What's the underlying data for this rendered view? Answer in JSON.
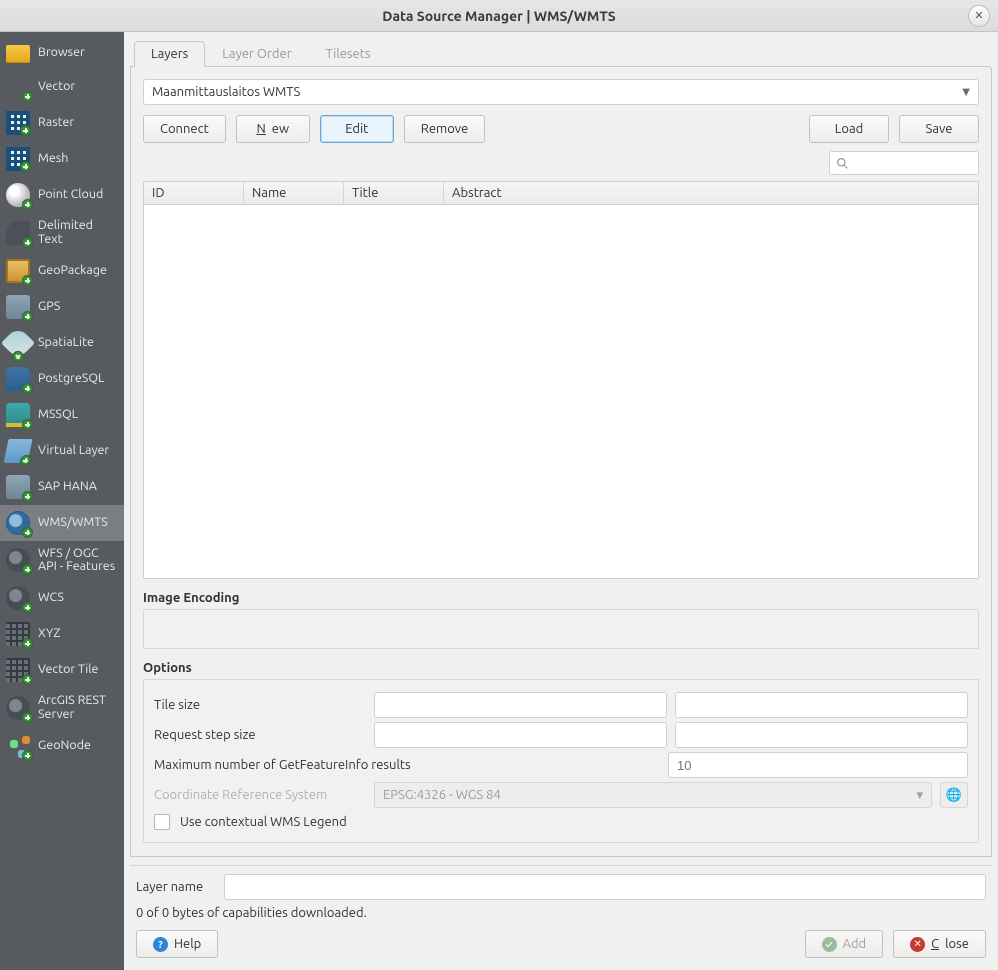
{
  "window": {
    "title": "Data Source Manager | WMS/WMTS"
  },
  "sidebar": {
    "items": [
      {
        "label": "Browser",
        "icon": "folder-icon",
        "iconcls": "ic-folder"
      },
      {
        "label": "Vector",
        "icon": "vector-icon",
        "iconcls": ""
      },
      {
        "label": "Raster",
        "icon": "raster-icon",
        "iconcls": "ic-grid"
      },
      {
        "label": "Mesh",
        "icon": "mesh-icon",
        "iconcls": "ic-grid"
      },
      {
        "label": "Point Cloud",
        "icon": "point-cloud-icon",
        "iconcls": "ic-ball"
      },
      {
        "label": "Delimited Text",
        "icon": "delimited-icon",
        "iconcls": "ic-quote"
      },
      {
        "label": "GeoPackage",
        "icon": "geopkg-icon",
        "iconcls": "ic-box"
      },
      {
        "label": "GPS",
        "icon": "gps-icon",
        "iconcls": "ic-badge"
      },
      {
        "label": "SpatiaLite",
        "icon": "spatialite-icon",
        "iconcls": "ic-leaf"
      },
      {
        "label": "PostgreSQL",
        "icon": "postgres-icon",
        "iconcls": "ic-elephant"
      },
      {
        "label": "MSSQL",
        "icon": "mssql-icon",
        "iconcls": "ic-teal"
      },
      {
        "label": "Virtual Layer",
        "icon": "vlayer-icon",
        "iconcls": "ic-layers"
      },
      {
        "label": "SAP HANA",
        "icon": "hana-icon",
        "iconcls": "ic-badge"
      },
      {
        "label": "WMS/WMTS",
        "icon": "wms-icon",
        "iconcls": "ic-globe",
        "selected": true
      },
      {
        "label": "WFS / OGC API - Features",
        "icon": "wfs-icon",
        "iconcls": "ic-globedark"
      },
      {
        "label": "WCS",
        "icon": "wcs-icon",
        "iconcls": "ic-globedark"
      },
      {
        "label": "XYZ",
        "icon": "xyz-icon",
        "iconcls": "ic-tiles"
      },
      {
        "label": "Vector Tile",
        "icon": "vectortile-icon",
        "iconcls": "ic-tiles"
      },
      {
        "label": "ArcGIS REST Server",
        "icon": "arcgis-icon",
        "iconcls": "ic-globedark"
      },
      {
        "label": "GeoNode",
        "icon": "geonode-icon",
        "iconcls": "ic-node"
      }
    ]
  },
  "tabs": {
    "items": [
      {
        "label": "Layers",
        "active": true
      },
      {
        "label": "Layer Order",
        "active": false
      },
      {
        "label": "Tilesets",
        "active": false
      }
    ]
  },
  "connection": {
    "selected": "Maanmittauslaitos WMTS"
  },
  "buttons": {
    "connect": "Connect",
    "newbtn": "New",
    "edit": "Edit",
    "remove": "Remove",
    "load": "Load",
    "save": "Save"
  },
  "table": {
    "columns": {
      "id": "ID",
      "name": "Name",
      "title": "Title",
      "abstract": "Abstract"
    }
  },
  "image_encoding": {
    "title": "Image Encoding"
  },
  "options": {
    "title": "Options",
    "tile_size": "Tile size",
    "request_step": "Request step size",
    "max_feature_info": "Maximum number of GetFeatureInfo results",
    "max_feature_info_value": "10",
    "crs_label": "Coordinate Reference System",
    "crs_value": "EPSG:4326 - WGS 84",
    "contextual": "Use contextual WMS Legend"
  },
  "layer_name": {
    "label": "Layer name",
    "value": ""
  },
  "status": "0 of 0 bytes of capabilities downloaded.",
  "footer": {
    "help": "Help",
    "add": "Add",
    "close": "Close"
  }
}
